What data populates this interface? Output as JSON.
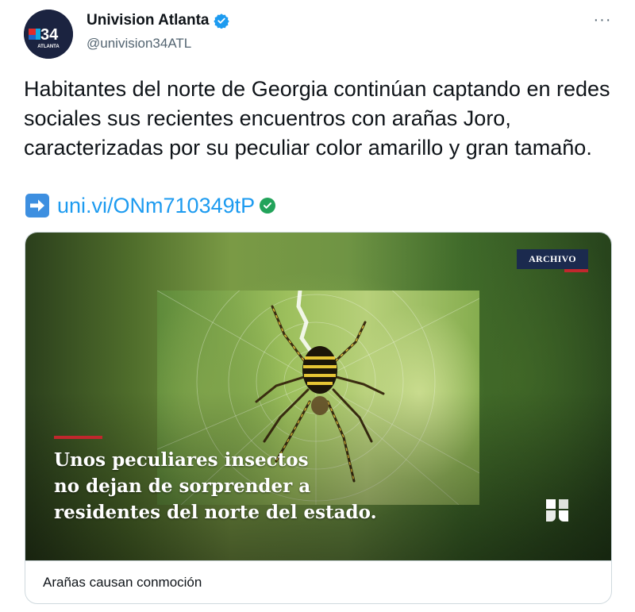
{
  "account": {
    "name": "Univision Atlanta",
    "handle": "@univision34ATL",
    "avatar_number": "34",
    "avatar_caption": "ATLANTA",
    "verified": true
  },
  "menu_icon": "more-horizontal-icon",
  "tweet": {
    "text": "Habitantes del norte de Georgia continúan captando en redes sociales sus recientes encuentros con arañas Joro, caracterizadas por su peculiar color amarillo y gran tamaño.",
    "link_text": "uni.vi/ONm710349tP"
  },
  "card": {
    "badge": "ARCHIVO",
    "headline_lines": [
      "Unos peculiares insectos",
      "no dejan de sorprender a",
      "residentes del norte del estado."
    ],
    "title": "Arañas causan conmoción"
  },
  "colors": {
    "link": "#1d9bf0",
    "verified": "#1d9bf0",
    "badge_bg": "#1b2a4e",
    "accent_red": "#c1272d"
  }
}
